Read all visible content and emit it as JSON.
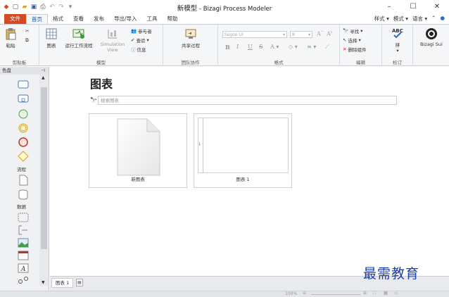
{
  "window": {
    "title_doc": "新模型",
    "title_app": " - Bizagi Process Modeler",
    "controls": [
      "–",
      "☐",
      "✕"
    ]
  },
  "menu": {
    "tabs": [
      "文件",
      "首页",
      "格式",
      "查看",
      "发布",
      "导出/导入",
      "工具",
      "帮助"
    ],
    "right": [
      "样式 ▾",
      "模式 ▾",
      "语言 ▾",
      "⌃"
    ]
  },
  "ribbon": {
    "clipboard": {
      "paste": "粘贴",
      "label": "剪贴板"
    },
    "model": {
      "chart": "图表",
      "run": "运行工作流程",
      "simulation": "Simulation View",
      "participants": "参与者",
      "check": "查验",
      "info": "信息",
      "label": "模型"
    },
    "team": {
      "share": "共享过程",
      "label": "团队协作"
    },
    "format": {
      "font": "Segoe UI",
      "size": "8",
      "label": "格式"
    },
    "edit": {
      "find": "寻找",
      "select": "选择",
      "delete": "删除组件",
      "label": "编辑"
    },
    "review": {
      "spell": "拼",
      "label": "检订"
    },
    "bizagi": {
      "label": "Bizagi Sui"
    }
  },
  "palette": {
    "header": "色盘",
    "flow_label": "流程",
    "data_label": "数据"
  },
  "main": {
    "heading": "图表",
    "search_placeholder": "搜索图表",
    "cards": [
      {
        "label": "新图表"
      },
      {
        "label": "图表 1"
      }
    ]
  },
  "bottom_tabs": {
    "tab1": "图表 1"
  },
  "status": {
    "zoom": "100%"
  },
  "watermark": "最需教育"
}
